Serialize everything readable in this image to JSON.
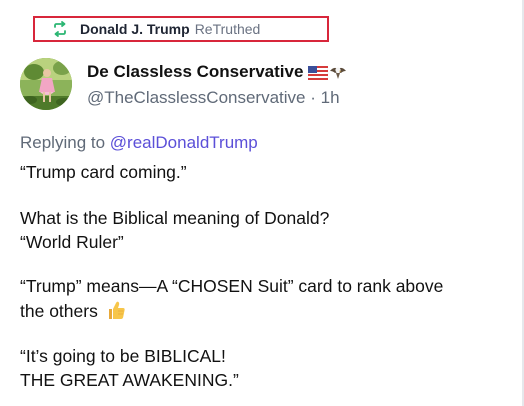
{
  "retruth": {
    "icon": "retruth-icon",
    "name": "Donald J. Trump",
    "label": "ReTruthed",
    "accent_color": "#2bb673",
    "highlight_border_color": "#d8263b"
  },
  "author": {
    "display_name": "De Classless Conservative",
    "badges": [
      "us-flag-icon",
      "eagle-icon"
    ],
    "handle": "@TheClasslessConservative",
    "separator": "·",
    "time": "1h"
  },
  "post": {
    "replying_to_prefix": "Replying to",
    "replying_to_handle": "@realDonaldTrump",
    "mention_color": "#5b4fd8",
    "lines": [
      "“Trump card coming.”",
      "What is the Biblical meaning of Donald?",
      "“World Ruler”",
      "“Trump” means—A “CHOSEN Suit” card to rank above",
      "the others",
      "“It’s going to be BIBLICAL!",
      "THE GREAT AWAKENING.”"
    ],
    "inline_emoji": "thumbs-up-icon"
  }
}
